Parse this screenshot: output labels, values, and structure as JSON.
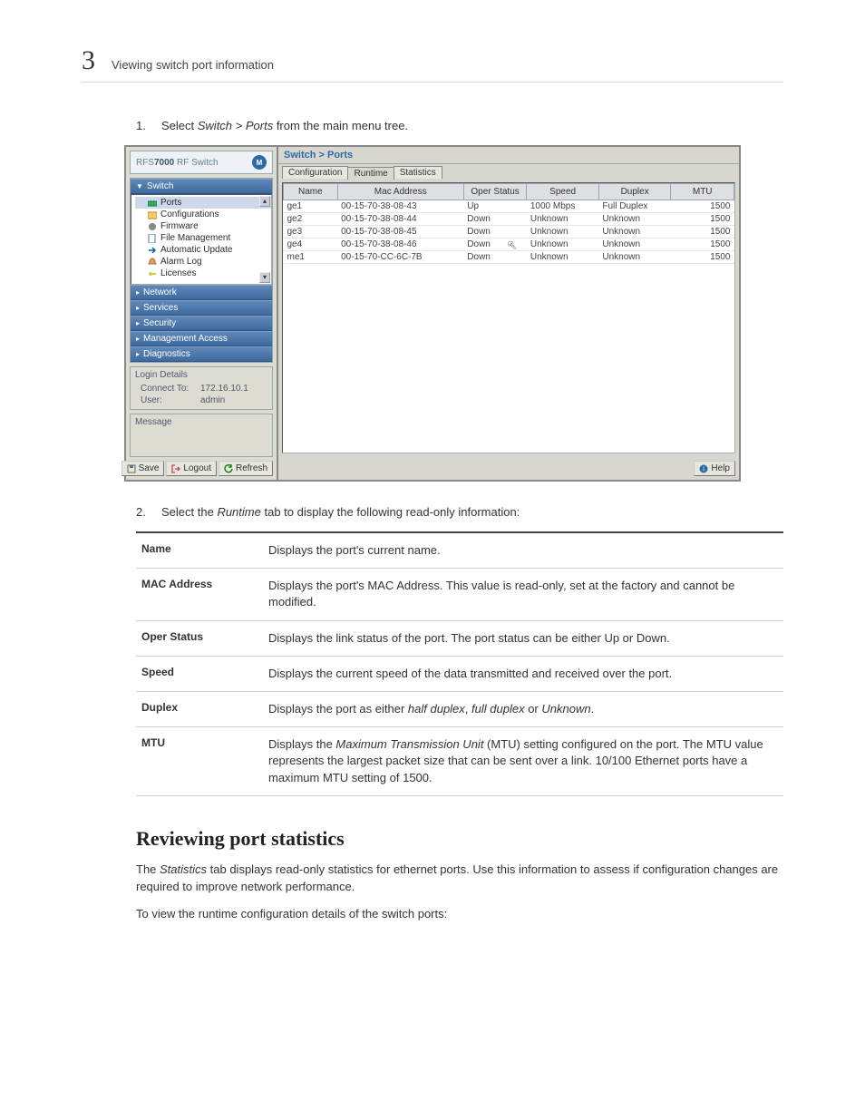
{
  "page_head": {
    "num": "3",
    "title": "Viewing switch port information"
  },
  "step1": {
    "num": "1.",
    "pre": "Select ",
    "path": "Switch > Ports",
    "post": " from the main menu tree."
  },
  "app": {
    "brand_pre": "RFS",
    "brand_bold": "7000",
    "brand_post": " RF Switch",
    "breadcrumb": "Switch > Ports",
    "tabs": [
      "Configuration",
      "Runtime",
      "Statistics"
    ],
    "nav_sections": [
      "Switch",
      "Network",
      "Services",
      "Security",
      "Management Access",
      "Diagnostics"
    ],
    "tree": [
      "Ports",
      "Configurations",
      "Firmware",
      "File Management",
      "Automatic Update",
      "Alarm Log",
      "Licenses"
    ],
    "login": {
      "heading": "Login Details",
      "connect_lbl": "Connect To:",
      "connect_val": "172.16.10.1",
      "user_lbl": "User:",
      "user_val": "admin"
    },
    "msg_heading": "Message",
    "buttons": {
      "save": "Save",
      "logout": "Logout",
      "refresh": "Refresh",
      "help": "Help"
    },
    "grid": {
      "headers": [
        "Name",
        "Mac Address",
        "Oper Status",
        "Speed",
        "Duplex",
        "MTU"
      ],
      "rows": [
        [
          "ge1",
          "00-15-70-38-08-43",
          "Up",
          "1000 Mbps",
          "Full Duplex",
          "1500"
        ],
        [
          "ge2",
          "00-15-70-38-08-44",
          "Down",
          "Unknown",
          "Unknown",
          "1500"
        ],
        [
          "ge3",
          "00-15-70-38-08-45",
          "Down",
          "Unknown",
          "Unknown",
          "1500"
        ],
        [
          "ge4",
          "00-15-70-38-08-46",
          "Down",
          "Unknown",
          "Unknown",
          "1500"
        ],
        [
          "me1",
          "00-15-70-CC-6C-7B",
          "Down",
          "Unknown",
          "Unknown",
          "1500"
        ]
      ]
    }
  },
  "step2": {
    "num": "2.",
    "pre": "Select the ",
    "tab": "Runtime",
    "post": " tab to display the following read-only information:"
  },
  "def_rows": [
    {
      "k": "Name",
      "v": "Displays the port's current name."
    },
    {
      "k": "MAC Address",
      "v": "Displays the port's MAC Address. This value is read-only, set at the factory and cannot be modified."
    },
    {
      "k": "Oper Status",
      "v": "Displays the link status of the port. The port status can be either Up or Down."
    },
    {
      "k": "Speed",
      "v": "Displays the current speed of the data transmitted and received over the port."
    },
    {
      "k": "Duplex",
      "v_pre": "Displays the port as either ",
      "i1": "half duplex",
      "mid1": ", ",
      "i2": "full duplex",
      "mid2": " or ",
      "i3": "Unknown",
      "v_post": "."
    },
    {
      "k": "MTU",
      "v_pre": "Displays the ",
      "i1": "Maximum Transmission Unit",
      "v_post": " (MTU) setting configured on the port. The MTU value represents the largest packet size that can be sent over a link. 10/100 Ethernet ports have a maximum MTU setting of 1500."
    }
  ],
  "section_h": "Reviewing port statistics",
  "section_p1_pre": "The ",
  "section_p1_i": "Statistics",
  "section_p1_post": " tab displays read-only statistics for ethernet ports. Use this information to assess if configuration changes are required to improve network performance.",
  "section_p2": "To view the runtime configuration details of the switch ports:"
}
